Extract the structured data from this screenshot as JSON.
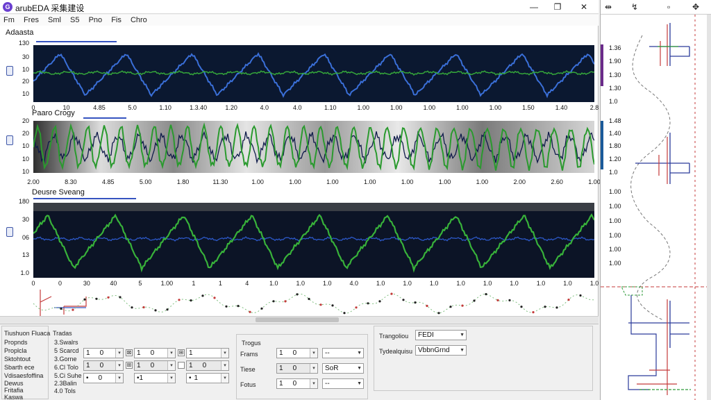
{
  "window": {
    "logo": "G",
    "title": "arubEDA 采集建设",
    "min_label": "—",
    "max_label": "❐",
    "close_label": "✕"
  },
  "menu": [
    "Fm",
    "Fres",
    "Sml",
    "S5",
    "Pno",
    "Fis",
    "Chro"
  ],
  "panels": [
    {
      "label": "Adaasta",
      "y_ticks": [
        "130",
        "30",
        "10",
        "20",
        "10"
      ],
      "x_ticks": [
        "0",
        "10",
        "4.85",
        "5.0",
        "1.10",
        "1.3.40",
        "1.20",
        "4.0",
        "4.0",
        "1.10",
        "1.00",
        "1.00",
        "1.00",
        "1.00",
        "1.00",
        "1.50",
        "1.40",
        "2.8"
      ],
      "colors": {
        "bg": "#0b1830",
        "series_a": "#3a6fd8",
        "series_b": "#35a63a"
      }
    },
    {
      "label": "Paaro Crogy",
      "y_ticks": [
        "20",
        "20",
        "10",
        "10",
        "10"
      ],
      "x_ticks": [
        "2.00",
        "8.30",
        "4.85",
        "5.00",
        "1.80",
        "11.30",
        "1.00",
        "1.00",
        "1.00",
        "1.00",
        "1.00",
        "1.00",
        "1.00",
        "2.00",
        "2.60",
        "1.00"
      ],
      "colors": {
        "series_a": "#2a9a2e",
        "series_b": "#0e1a4a"
      }
    },
    {
      "label": "Deusre Sveang",
      "y_ticks": [
        "180",
        "30",
        "06",
        "13",
        "1.0"
      ],
      "x_ticks": [
        "0",
        "0",
        "30",
        "40",
        "5",
        "1.00",
        "1",
        "1",
        "4",
        "1.0",
        "1.0",
        "1.0",
        "4.0",
        "1.0",
        "1.0",
        "1.0",
        "1.0",
        "1.0",
        "1.0",
        "1.0",
        "1.0",
        "1.0"
      ],
      "colors": {
        "bg": "#0c1426",
        "series_a": "#38b23a",
        "series_b": "#2c58c8"
      }
    }
  ],
  "right_panel": {
    "header_icons": [
      "⇹",
      "↯",
      "▫",
      "✥"
    ],
    "ticks_top": [
      "1.36",
      "1.90",
      "1.30",
      "1.30",
      "1.0"
    ],
    "ticks_mid": [
      "1.48",
      "1.40",
      "1.80",
      "1.20",
      "1.0"
    ],
    "ticks_bot": [
      "1.00",
      "1.00",
      "1.00",
      "1.00",
      "1.00",
      "1.00"
    ]
  },
  "bottom": {
    "left_labels": [
      "Tiushuon Fluaca",
      "Propnds",
      "Proplcla",
      "Sktohtout",
      "Sbarth ece",
      "Vdisaesfoffina",
      "Dewus",
      "Fritafia",
      "Kaswa"
    ],
    "col2_header": "Tradas",
    "col2_values": [
      "3.Swalrs",
      "5 Scarcd",
      "3.Gorne",
      "6.Cl Tolo",
      "5.Ci Suhe",
      "2.3Balin",
      "4.0 Tols"
    ],
    "row1": [
      "1",
      "1",
      "1"
    ],
    "row2": [
      "1",
      "1",
      "1"
    ],
    "row3": [
      "0",
      "•1",
      "1"
    ],
    "chk_marks": [
      "⊠",
      "⊞",
      "⊞"
    ],
    "mid_header": "Trogus",
    "mid_rows": [
      {
        "label": "Frams",
        "value": "1",
        "combo": "--"
      },
      {
        "label": "Tiese",
        "value": "1",
        "combo": "SoR"
      },
      {
        "label": "Fotus",
        "value": "1",
        "combo": "--"
      }
    ],
    "right_rows": [
      {
        "label": "Trangoliou",
        "value": "FEDI"
      },
      {
        "label": "Tydealquisu",
        "value": "VbbnGrnd"
      }
    ]
  }
}
